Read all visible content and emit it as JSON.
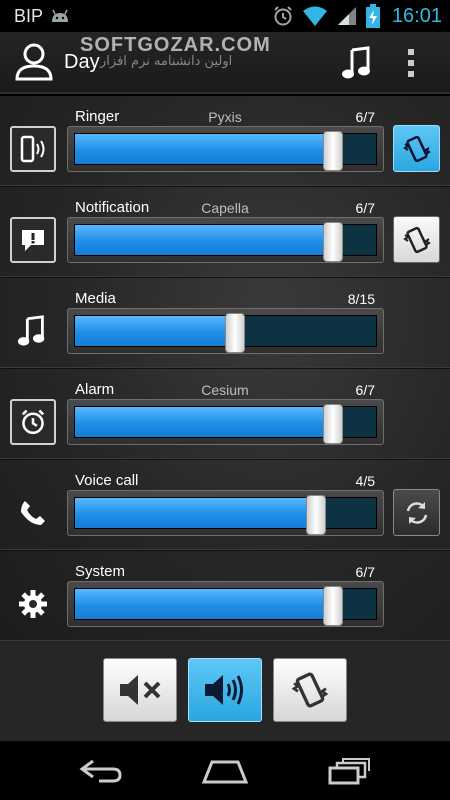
{
  "status_bar": {
    "carrier": "BIP",
    "time": "16:01",
    "icons": [
      "android-robot-icon",
      "alarm-clock-icon",
      "wifi-icon",
      "signal-icon",
      "battery-charging-icon"
    ]
  },
  "action_bar": {
    "title": "Day",
    "watermark": "SOFTGOZAR.COM",
    "watermark_sub": "اولین دانشنامه نرم افزار",
    "icons": [
      "profile-icon",
      "music-note-icon",
      "overflow-menu-icon"
    ]
  },
  "streams": [
    {
      "label": "Ringer",
      "sound": "Pyxis",
      "count": "6/7",
      "level": 0.857,
      "icon": "ringer-icon",
      "right_icon": "vibrate-icon",
      "right_state": "active"
    },
    {
      "label": "Notification",
      "sound": "Capella",
      "count": "6/7",
      "level": 0.857,
      "icon": "notification-icon",
      "right_icon": "vibrate-icon",
      "right_state": "light"
    },
    {
      "label": "Media",
      "sound": "",
      "count": "8/15",
      "level": 0.533,
      "icon": "music-note-icon"
    },
    {
      "label": "Alarm",
      "sound": "Cesium",
      "count": "6/7",
      "level": 0.857,
      "icon": "alarm-clock-icon"
    },
    {
      "label": "Voice call",
      "sound": "",
      "count": "4/5",
      "level": 0.8,
      "icon": "phone-icon",
      "right_icon": "sync-icon",
      "right_state": "dark"
    },
    {
      "label": "System",
      "sound": "",
      "count": "6/7",
      "level": 0.857,
      "icon": "gear-icon"
    }
  ],
  "modes": [
    {
      "name": "silent",
      "icon": "mute-speaker-icon",
      "state": "light"
    },
    {
      "name": "sound",
      "icon": "speaker-icon",
      "state": "active"
    },
    {
      "name": "vibrate",
      "icon": "vibrate-icon",
      "state": "light"
    }
  ],
  "nav": [
    "back-icon",
    "home-icon",
    "recent-apps-icon"
  ],
  "colors": {
    "accent": "#33b5e5",
    "slider_fill": "#1f8ee8",
    "active_button": "#2aa6e0"
  }
}
